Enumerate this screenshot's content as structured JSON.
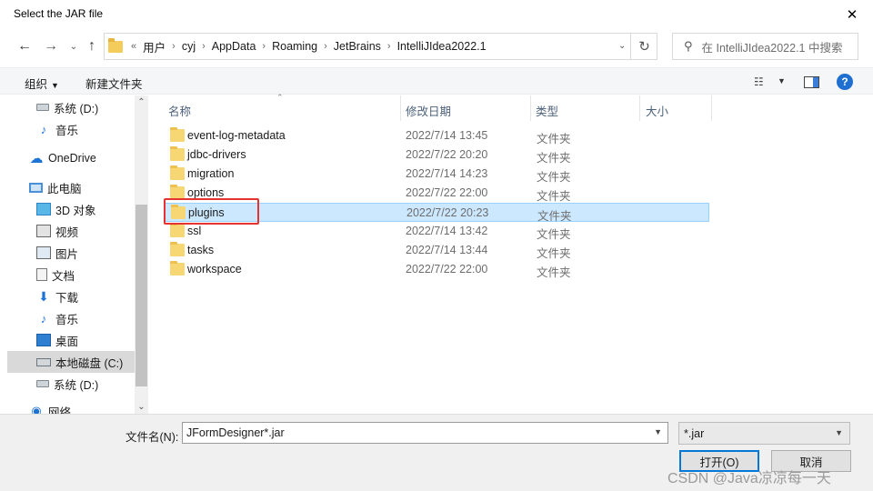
{
  "window": {
    "title": "Select the JAR file",
    "close_glyph": "✕"
  },
  "address": {
    "crumbs": [
      "用户",
      "cyj",
      "AppData",
      "Roaming",
      "JetBrains",
      "IntelliJIdea2022.1"
    ],
    "prefix": "«",
    "separator": "›"
  },
  "search": {
    "placeholder": "在 IntelliJIdea2022.1 中搜索"
  },
  "toolbar": {
    "organize": "组织",
    "new_folder": "新建文件夹"
  },
  "sidebar": {
    "items": [
      {
        "label": "系统 (D:)",
        "icon": "drive-icon"
      },
      {
        "label": "音乐",
        "icon": "music-icon"
      },
      {
        "label": "OneDrive",
        "icon": "cloud-icon"
      },
      {
        "label": "此电脑",
        "icon": "pc-icon"
      },
      {
        "label": "3D 对象",
        "icon": "3d-objects-icon"
      },
      {
        "label": "视频",
        "icon": "video-icon"
      },
      {
        "label": "图片",
        "icon": "pictures-icon"
      },
      {
        "label": "文档",
        "icon": "documents-icon"
      },
      {
        "label": "下载",
        "icon": "downloads-icon"
      },
      {
        "label": "音乐",
        "icon": "music-icon"
      },
      {
        "label": "桌面",
        "icon": "desktop-icon"
      },
      {
        "label": "本地磁盘 (C:)",
        "icon": "local-disk-icon",
        "selected": true
      },
      {
        "label": "系统 (D:)",
        "icon": "drive-icon"
      },
      {
        "label": "网络",
        "icon": "network-icon"
      }
    ]
  },
  "columns": {
    "name": "名称",
    "date": "修改日期",
    "type": "类型",
    "size": "大小"
  },
  "files": [
    {
      "name": "event-log-metadata",
      "date": "2022/7/14 13:45",
      "type": "文件夹"
    },
    {
      "name": "jdbc-drivers",
      "date": "2022/7/22 20:20",
      "type": "文件夹"
    },
    {
      "name": "migration",
      "date": "2022/7/14 14:23",
      "type": "文件夹"
    },
    {
      "name": "options",
      "date": "2022/7/22 22:00",
      "type": "文件夹"
    },
    {
      "name": "plugins",
      "date": "2022/7/22 20:23",
      "type": "文件夹",
      "selected": true
    },
    {
      "name": "ssl",
      "date": "2022/7/14 13:42",
      "type": "文件夹"
    },
    {
      "name": "tasks",
      "date": "2022/7/14 13:44",
      "type": "文件夹"
    },
    {
      "name": "workspace",
      "date": "2022/7/22 22:00",
      "type": "文件夹"
    }
  ],
  "bottom": {
    "filename_label": "文件名(N):",
    "filename_value": "JFormDesigner*.jar",
    "filter_value": "*.jar",
    "open_button": "打开(O)",
    "cancel_button": "取消"
  },
  "watermark": "CSDN @Java凉凉每一天",
  "colors": {
    "selection_bg": "#cce8ff",
    "highlight_border": "#e53333",
    "accent": "#0078d7"
  }
}
